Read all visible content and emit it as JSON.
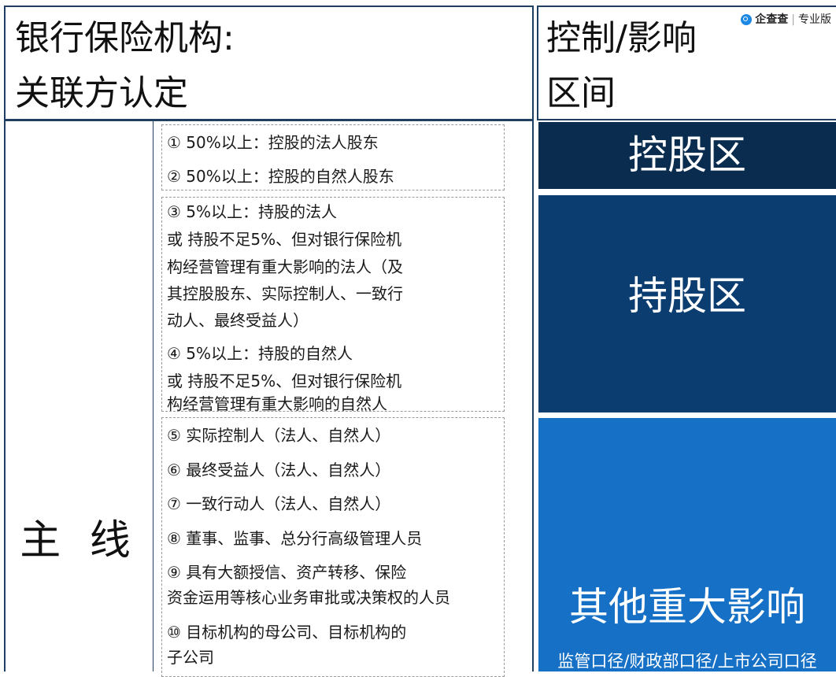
{
  "left_title": {
    "line1": "银行保险机构:",
    "line2": "关联方认定"
  },
  "right_title": {
    "line1": "控制/影响",
    "line2": "区间"
  },
  "brand": {
    "name": "企查查",
    "edition": "专业版",
    "separator": "|"
  },
  "mainline": {
    "label": "主 线"
  },
  "groups": [
    {
      "items": [
        "① 50%以上：控股的法人股东",
        "② 50%以上：控股的自然人股东"
      ]
    },
    {
      "items": [
        "③ 5%以上：持股的法人",
        "或 持股不足5%、但对银行保险机",
        "构经营管理有重大影响的法人（及",
        "其控股股东、实际控制人、一致行",
        "动人、最终受益人）",
        "④ 5%以上：持股的自然人",
        "或 持股不足5%、但对银行保险机",
        "构经营管理有重大影响的自然人"
      ]
    },
    {
      "items": [
        "⑤ 实际控制人（法人、自然人）",
        "⑥ 最终受益人（法人、自然人）",
        "⑦ 一致行动人（法人、自然人）",
        "⑧ 董事、监事、总分行高级管理人员",
        "⑨ 具有大额授信、资产转移、保险",
        "资金运用等核心业务审批或决策权的人员",
        "⑩ 目标机构的母公司、目标机构的",
        "子公司"
      ]
    }
  ],
  "zones": {
    "control": "控股区",
    "holding": "持股区",
    "other": "其他重大影响",
    "other_note": "监管口径/财政部口径/上市公司口径"
  },
  "colors": {
    "control": "#0a2d4f",
    "holding": "#0b3d70",
    "other": "#1670c6",
    "border": "#1f3f63",
    "brand_logo": "#1e88e5"
  }
}
